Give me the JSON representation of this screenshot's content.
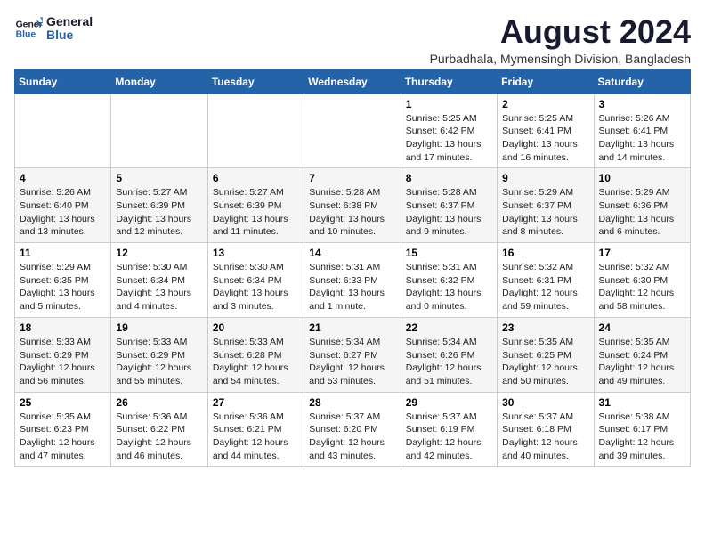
{
  "logo": {
    "line1": "General",
    "line2": "Blue"
  },
  "title": "August 2024",
  "subtitle": "Purbadhala, Mymensingh Division, Bangladesh",
  "weekdays": [
    "Sunday",
    "Monday",
    "Tuesday",
    "Wednesday",
    "Thursday",
    "Friday",
    "Saturday"
  ],
  "weeks": [
    [
      {
        "day": "",
        "info": ""
      },
      {
        "day": "",
        "info": ""
      },
      {
        "day": "",
        "info": ""
      },
      {
        "day": "",
        "info": ""
      },
      {
        "day": "1",
        "info": "Sunrise: 5:25 AM\nSunset: 6:42 PM\nDaylight: 13 hours\nand 17 minutes."
      },
      {
        "day": "2",
        "info": "Sunrise: 5:25 AM\nSunset: 6:41 PM\nDaylight: 13 hours\nand 16 minutes."
      },
      {
        "day": "3",
        "info": "Sunrise: 5:26 AM\nSunset: 6:41 PM\nDaylight: 13 hours\nand 14 minutes."
      }
    ],
    [
      {
        "day": "4",
        "info": "Sunrise: 5:26 AM\nSunset: 6:40 PM\nDaylight: 13 hours\nand 13 minutes."
      },
      {
        "day": "5",
        "info": "Sunrise: 5:27 AM\nSunset: 6:39 PM\nDaylight: 13 hours\nand 12 minutes."
      },
      {
        "day": "6",
        "info": "Sunrise: 5:27 AM\nSunset: 6:39 PM\nDaylight: 13 hours\nand 11 minutes."
      },
      {
        "day": "7",
        "info": "Sunrise: 5:28 AM\nSunset: 6:38 PM\nDaylight: 13 hours\nand 10 minutes."
      },
      {
        "day": "8",
        "info": "Sunrise: 5:28 AM\nSunset: 6:37 PM\nDaylight: 13 hours\nand 9 minutes."
      },
      {
        "day": "9",
        "info": "Sunrise: 5:29 AM\nSunset: 6:37 PM\nDaylight: 13 hours\nand 8 minutes."
      },
      {
        "day": "10",
        "info": "Sunrise: 5:29 AM\nSunset: 6:36 PM\nDaylight: 13 hours\nand 6 minutes."
      }
    ],
    [
      {
        "day": "11",
        "info": "Sunrise: 5:29 AM\nSunset: 6:35 PM\nDaylight: 13 hours\nand 5 minutes."
      },
      {
        "day": "12",
        "info": "Sunrise: 5:30 AM\nSunset: 6:34 PM\nDaylight: 13 hours\nand 4 minutes."
      },
      {
        "day": "13",
        "info": "Sunrise: 5:30 AM\nSunset: 6:34 PM\nDaylight: 13 hours\nand 3 minutes."
      },
      {
        "day": "14",
        "info": "Sunrise: 5:31 AM\nSunset: 6:33 PM\nDaylight: 13 hours\nand 1 minute."
      },
      {
        "day": "15",
        "info": "Sunrise: 5:31 AM\nSunset: 6:32 PM\nDaylight: 13 hours\nand 0 minutes."
      },
      {
        "day": "16",
        "info": "Sunrise: 5:32 AM\nSunset: 6:31 PM\nDaylight: 12 hours\nand 59 minutes."
      },
      {
        "day": "17",
        "info": "Sunrise: 5:32 AM\nSunset: 6:30 PM\nDaylight: 12 hours\nand 58 minutes."
      }
    ],
    [
      {
        "day": "18",
        "info": "Sunrise: 5:33 AM\nSunset: 6:29 PM\nDaylight: 12 hours\nand 56 minutes."
      },
      {
        "day": "19",
        "info": "Sunrise: 5:33 AM\nSunset: 6:29 PM\nDaylight: 12 hours\nand 55 minutes."
      },
      {
        "day": "20",
        "info": "Sunrise: 5:33 AM\nSunset: 6:28 PM\nDaylight: 12 hours\nand 54 minutes."
      },
      {
        "day": "21",
        "info": "Sunrise: 5:34 AM\nSunset: 6:27 PM\nDaylight: 12 hours\nand 53 minutes."
      },
      {
        "day": "22",
        "info": "Sunrise: 5:34 AM\nSunset: 6:26 PM\nDaylight: 12 hours\nand 51 minutes."
      },
      {
        "day": "23",
        "info": "Sunrise: 5:35 AM\nSunset: 6:25 PM\nDaylight: 12 hours\nand 50 minutes."
      },
      {
        "day": "24",
        "info": "Sunrise: 5:35 AM\nSunset: 6:24 PM\nDaylight: 12 hours\nand 49 minutes."
      }
    ],
    [
      {
        "day": "25",
        "info": "Sunrise: 5:35 AM\nSunset: 6:23 PM\nDaylight: 12 hours\nand 47 minutes."
      },
      {
        "day": "26",
        "info": "Sunrise: 5:36 AM\nSunset: 6:22 PM\nDaylight: 12 hours\nand 46 minutes."
      },
      {
        "day": "27",
        "info": "Sunrise: 5:36 AM\nSunset: 6:21 PM\nDaylight: 12 hours\nand 44 minutes."
      },
      {
        "day": "28",
        "info": "Sunrise: 5:37 AM\nSunset: 6:20 PM\nDaylight: 12 hours\nand 43 minutes."
      },
      {
        "day": "29",
        "info": "Sunrise: 5:37 AM\nSunset: 6:19 PM\nDaylight: 12 hours\nand 42 minutes."
      },
      {
        "day": "30",
        "info": "Sunrise: 5:37 AM\nSunset: 6:18 PM\nDaylight: 12 hours\nand 40 minutes."
      },
      {
        "day": "31",
        "info": "Sunrise: 5:38 AM\nSunset: 6:17 PM\nDaylight: 12 hours\nand 39 minutes."
      }
    ]
  ]
}
